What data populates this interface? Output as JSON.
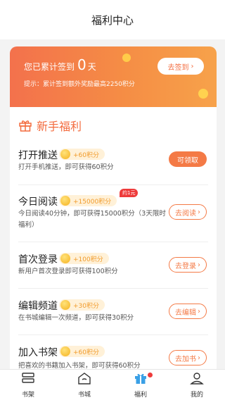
{
  "header": {
    "title": "福利中心"
  },
  "banner": {
    "signed_prefix": "您已累计签到",
    "signed_days": "0",
    "signed_suffix": "天",
    "tip": "提示：累计签到额外奖励最高2250积分",
    "sign_button": "去签到"
  },
  "section": {
    "title": "新手福利"
  },
  "tasks": [
    {
      "name": "打开推送",
      "reward": "+60积分",
      "desc": "打开手机推送，即可获得60积分",
      "button": "可领取"
    },
    {
      "name": "今日阅读",
      "reward": "+15000积分",
      "badge": "约1元",
      "desc": "今日阅读40分钟，即可获得15000积分（3天限时福利）",
      "button": "去阅读"
    },
    {
      "name": "首次登录",
      "reward": "+100积分",
      "desc": "新用户首次登录即可获得100积分",
      "button": "去登录"
    },
    {
      "name": "编辑频道",
      "reward": "+30积分",
      "desc": "在书城编辑一次频道，即可获得30积分",
      "button": "去编辑"
    },
    {
      "name": "加入书架",
      "reward": "+60积分",
      "desc": "把喜欢的书籍加入书架，即可获得60积分",
      "button": "去加书"
    }
  ],
  "tabbar": [
    {
      "label": "书架",
      "icon": "bookshelf-icon"
    },
    {
      "label": "书城",
      "icon": "bookstore-icon"
    },
    {
      "label": "福利",
      "icon": "gift-icon"
    },
    {
      "label": "我的",
      "icon": "profile-icon"
    }
  ],
  "colors": {
    "accent": "#f47a46",
    "banner_start": "#f3714c",
    "banner_end": "#f7a24a",
    "reward_bg": "#fff1d8",
    "badge": "#ee3b3b"
  }
}
